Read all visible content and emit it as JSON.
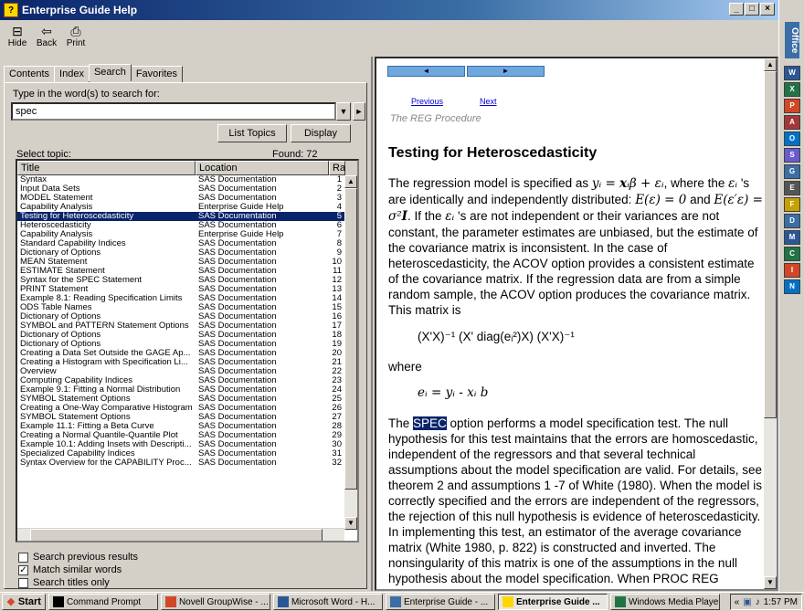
{
  "window": {
    "title": "Enterprise Guide Help",
    "minimize": "_",
    "maximize": "□",
    "close": "×"
  },
  "toolbar": {
    "hide_label": "Hide",
    "back_label": "Back",
    "print_label": "Print"
  },
  "tabs": [
    "Contents",
    "Index",
    "Search",
    "Favorites"
  ],
  "search": {
    "prompt": "Type in the word(s) to search for:",
    "value": "spec",
    "list_topics": "List Topics",
    "display": "Display",
    "select_topic": "Select topic:",
    "found": "Found: 72"
  },
  "results": {
    "columns": [
      "Title",
      "Location",
      "Ra"
    ],
    "rows": [
      [
        "Syntax",
        "SAS Documentation",
        "1"
      ],
      [
        "Input Data Sets",
        "SAS Documentation",
        "2"
      ],
      [
        "MODEL Statement",
        "SAS Documentation",
        "3"
      ],
      [
        "Capability Analysis",
        "Enterprise Guide Help",
        "4"
      ],
      [
        "Testing for Heteroscedasticity",
        "SAS Documentation",
        "5"
      ],
      [
        "Heteroscedasticity",
        "SAS Documentation",
        "6"
      ],
      [
        "Capability Analysis",
        "Enterprise Guide Help",
        "7"
      ],
      [
        "Standard Capability Indices",
        "SAS Documentation",
        "8"
      ],
      [
        "Dictionary of Options",
        "SAS Documentation",
        "9"
      ],
      [
        "MEAN Statement",
        "SAS Documentation",
        "10"
      ],
      [
        "ESTIMATE Statement",
        "SAS Documentation",
        "11"
      ],
      [
        "Syntax for the SPEC Statement",
        "SAS Documentation",
        "12"
      ],
      [
        "PRINT Statement",
        "SAS Documentation",
        "13"
      ],
      [
        "Example 8.1: Reading Specification Limits",
        "SAS Documentation",
        "14"
      ],
      [
        "ODS Table Names",
        "SAS Documentation",
        "15"
      ],
      [
        "Dictionary of Options",
        "SAS Documentation",
        "16"
      ],
      [
        "SYMBOL and PATTERN Statement Options",
        "SAS Documentation",
        "17"
      ],
      [
        "Dictionary of Options",
        "SAS Documentation",
        "18"
      ],
      [
        "Dictionary of Options",
        "SAS Documentation",
        "19"
      ],
      [
        "Creating a Data Set Outside the GAGE Ap...",
        "SAS Documentation",
        "20"
      ],
      [
        "Creating a Histogram with Specification Li...",
        "SAS Documentation",
        "21"
      ],
      [
        "Overview",
        "SAS Documentation",
        "22"
      ],
      [
        "Computing Capability Indices",
        "SAS Documentation",
        "23"
      ],
      [
        "Example 9.1: Fitting a Normal Distribution",
        "SAS Documentation",
        "24"
      ],
      [
        "SYMBOL Statement Options",
        "SAS Documentation",
        "25"
      ],
      [
        "Creating a One-Way Comparative Histogram",
        "SAS Documentation",
        "26"
      ],
      [
        "SYMBOL Statement Options",
        "SAS Documentation",
        "27"
      ],
      [
        "Example 11.1: Fitting a Beta Curve",
        "SAS Documentation",
        "28"
      ],
      [
        "Creating a Normal Quantile-Quantile Plot",
        "SAS Documentation",
        "29"
      ],
      [
        "Example 10.1: Adding Insets with Descripti...",
        "SAS Documentation",
        "30"
      ],
      [
        "Specialized Capability Indices",
        "SAS Documentation",
        "31"
      ],
      [
        "Syntax Overview for the CAPABILITY Proc...",
        "SAS Documentation",
        "32"
      ]
    ]
  },
  "options": {
    "search_previous": "Search previous results",
    "match_similar": "Match similar words",
    "search_titles": "Search titles only"
  },
  "doc": {
    "prev": "Previous",
    "next": "Next",
    "procedure": "The REG Procedure",
    "heading": "Testing for Heteroscedasticity",
    "p1a": "The regression model is specified as",
    "p1b": ", where the",
    "p1c": "'s are identically and independently distributed:",
    "p1d": "and",
    "p1e": ". If the",
    "p1f": "'s are not independent or their variances are not constant, the parameter estimates are unbiased, but the estimate of the covariance matrix is inconsistent. In the case of heteroscedasticity, the ACOV option provides a consistent estimate of the covariance matrix. If the regression data are from a simple random sample, the ACOV option produces the covariance matrix. This matrix is",
    "matrix": "(X'X)⁻¹ (X' diag(eᵢ²)X) (X'X)⁻¹",
    "where": "where",
    "resid": "eᵢ = yᵢ - xᵢ b",
    "spec_word": "SPEC",
    "p2": " option performs a model specification test. The null hypothesis for this test maintains that the errors are homoscedastic, independent of the regressors and that several technical assumptions about the model specification are valid. For details, see theorem 2 and assumptions 1 -7 of White (1980). When the model is correctly specified and the errors are independent of the regressors, the rejection of this null hypothesis is evidence of heteroscedasticity. In implementing this test, an estimator of the average covariance matrix (White 1980, p. 822) is constructed and inverted. The nonsingularity of this matrix is one of the assumptions in the null hypothesis about the model specification. When PROC REG determines this matrix to be"
  },
  "officebar": {
    "brand": "Office"
  },
  "taskbar": {
    "start": "Start",
    "tasks": [
      "Command Prompt",
      "Novell GroupWise - ...",
      "Microsoft Word - H...",
      "Enterprise Guide - ...",
      "Enterprise Guide ...",
      "Windows Media Player"
    ],
    "time": "1:57 PM",
    "tray_prefix": "«"
  }
}
